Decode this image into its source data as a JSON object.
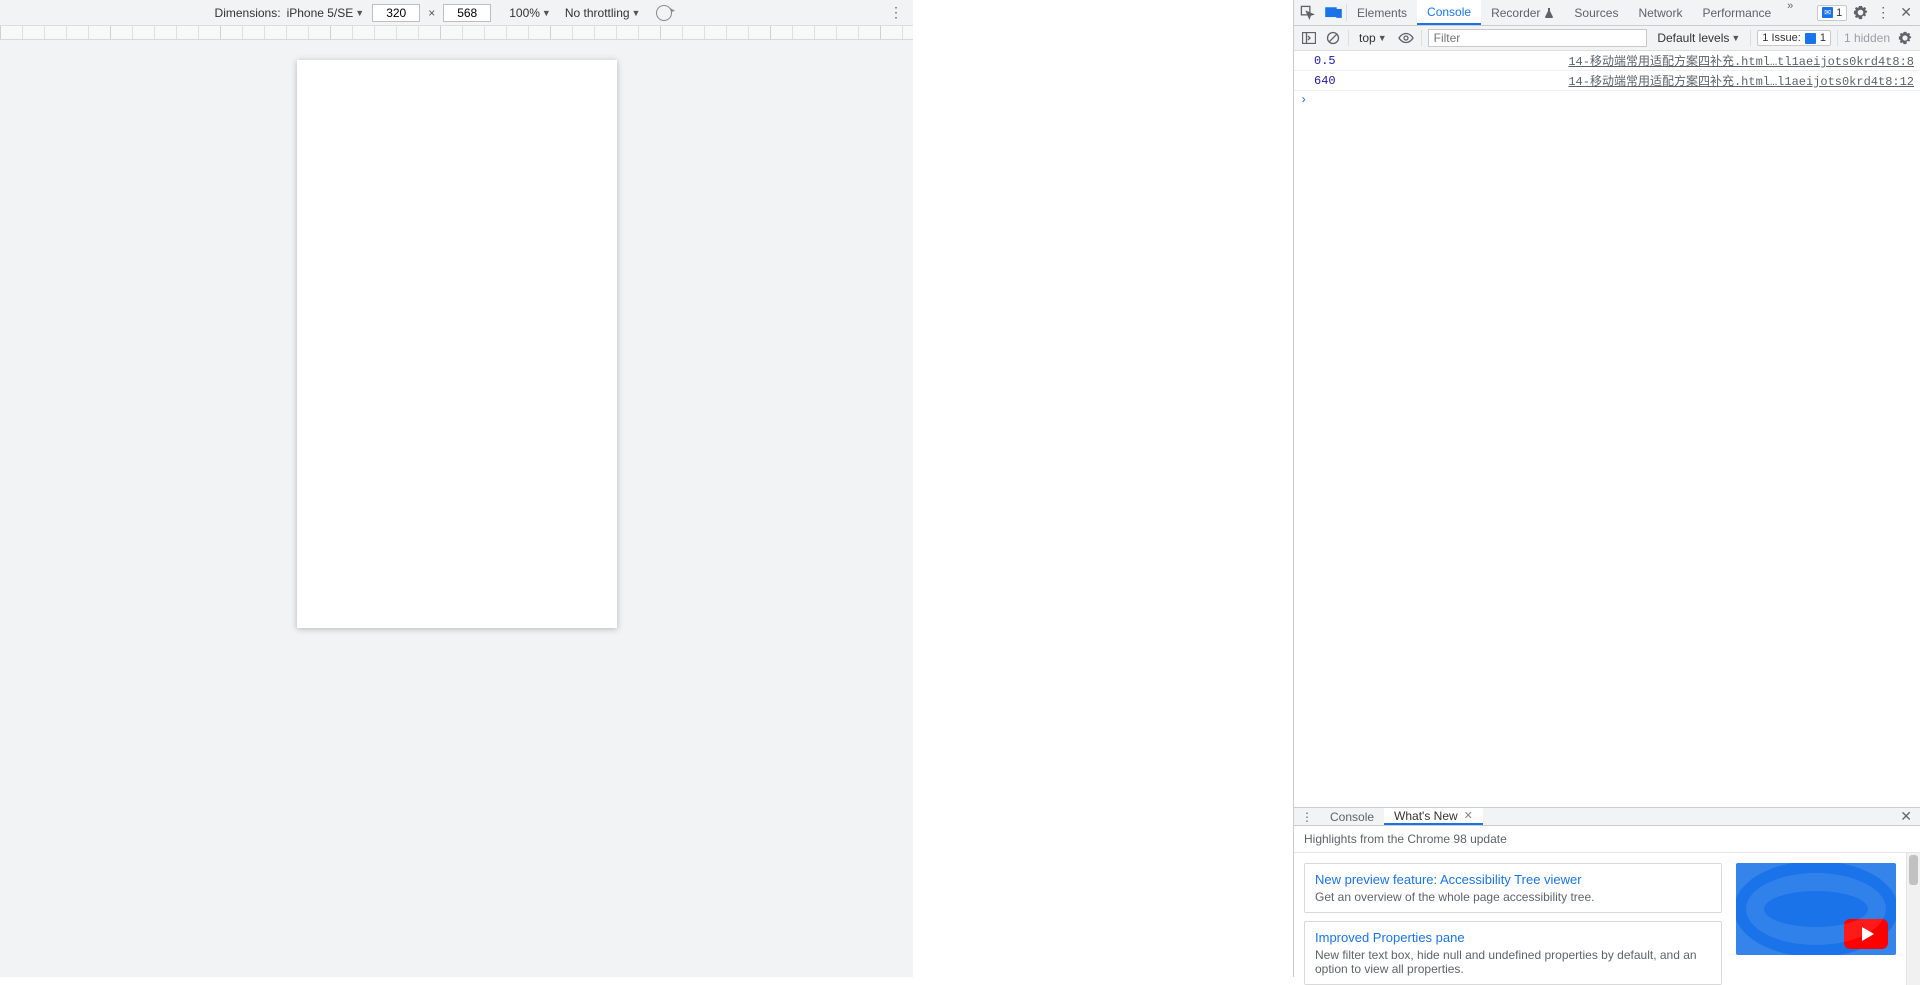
{
  "deviceBar": {
    "dimensionsLabel": "Dimensions:",
    "deviceName": "iPhone 5/SE",
    "width": "320",
    "height": "568",
    "multiply": "×",
    "zoom": "100%",
    "throttling": "No throttling"
  },
  "devtoolsTabs": {
    "elements": "Elements",
    "console": "Console",
    "recorder": "Recorder",
    "sources": "Sources",
    "network": "Network",
    "performance": "Performance",
    "issuesCount": "1"
  },
  "consoleToolbar": {
    "context": "top",
    "filterPlaceholder": "Filter",
    "levels": "Default levels",
    "issueLabel": "1 Issue:",
    "issueCount": "1",
    "hidden": "1 hidden"
  },
  "consoleRows": [
    {
      "value": "0.5",
      "source": "14-移动端常用适配方案四补充.html…tl1aeijots0krd4t8:8"
    },
    {
      "value": "640",
      "source": "14-移动端常用适配方案四补充.html…l1aeijots0krd4t8:12"
    }
  ],
  "drawer": {
    "consoleTab": "Console",
    "whatsNewTab": "What's New",
    "highlights": "Highlights from the Chrome 98 update",
    "cards": [
      {
        "title": "New preview feature: Accessibility Tree viewer",
        "desc": "Get an overview of the whole page accessibility tree."
      },
      {
        "title": "Improved Properties pane",
        "desc": "New filter text box, hide null and undefined properties by default, and an option to view all properties."
      }
    ]
  }
}
